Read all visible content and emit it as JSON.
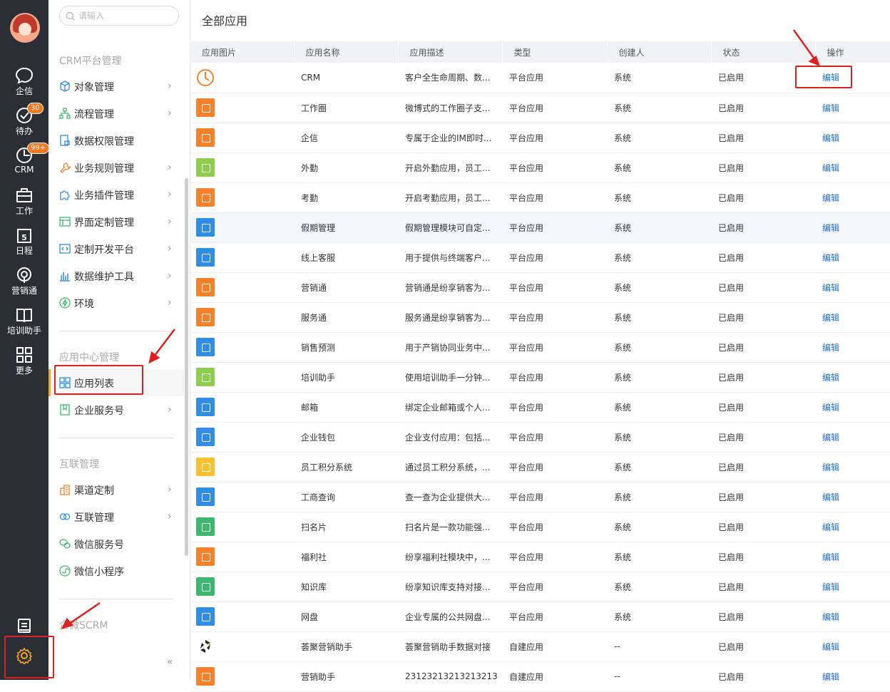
{
  "rail": {
    "items": [
      {
        "label": "企信",
        "icon": "chat-bubble-icon"
      },
      {
        "label": "待办",
        "icon": "check-circle-icon",
        "badge": "30"
      },
      {
        "label": "CRM",
        "icon": "pie-clock-icon",
        "badge": "99+"
      },
      {
        "label": "工作",
        "icon": "briefcase-icon"
      },
      {
        "label": "日程",
        "icon": "calendar-icon"
      },
      {
        "label": "营销通",
        "icon": "broadcast-icon"
      },
      {
        "label": "培训助手",
        "icon": "book-icon"
      },
      {
        "label": "更多",
        "icon": "grid-icon"
      }
    ]
  },
  "menu": {
    "search_placeholder": "请输入",
    "sections": [
      {
        "title": "CRM平台管理",
        "items": [
          {
            "label": "对象管理",
            "icon": "cube-icon",
            "chevron": true
          },
          {
            "label": "流程管理",
            "icon": "flow-icon",
            "chevron": true
          },
          {
            "label": "数据权限管理",
            "icon": "lock-doc-icon",
            "chevron": false
          },
          {
            "label": "业务规则管理",
            "icon": "wrench-icon",
            "chevron": true
          },
          {
            "label": "业务插件管理",
            "icon": "puzzle-icon",
            "chevron": true
          },
          {
            "label": "界面定制管理",
            "icon": "layout-icon",
            "chevron": true
          },
          {
            "label": "定制开发平台",
            "icon": "code-icon",
            "chevron": true
          },
          {
            "label": "数据维护工具",
            "icon": "bar-chart-icon",
            "chevron": true
          },
          {
            "label": "环境",
            "icon": "lightning-icon",
            "chevron": true
          }
        ]
      },
      {
        "title": "应用中心管理",
        "items": [
          {
            "label": "应用列表",
            "icon": "app-grid-icon",
            "chevron": false,
            "active": true
          },
          {
            "label": "企业服务号",
            "icon": "bookmark-icon",
            "chevron": true
          }
        ]
      },
      {
        "title": "互联管理",
        "items": [
          {
            "label": "渠道定制",
            "icon": "building-icon",
            "chevron": true
          },
          {
            "label": "互联管理",
            "icon": "link-rings-icon",
            "chevron": true
          },
          {
            "label": "微信服务号",
            "icon": "wechat-icon",
            "chevron": false
          },
          {
            "label": "微信小程序",
            "icon": "miniprogram-icon",
            "chevron": false
          }
        ]
      },
      {
        "title": "企微SCRM",
        "items": []
      }
    ],
    "collapse_glyph": "«"
  },
  "main": {
    "title": "全部应用",
    "columns": [
      "应用图片",
      "应用名称",
      "应用描述",
      "类型",
      "创建人",
      "状态",
      "操作"
    ],
    "rows": [
      {
        "icon_color": "#f5822a",
        "icon": "crm-clock-icon",
        "name": "CRM",
        "desc": "客户全生命周期、数...",
        "type": "平台应用",
        "creator": "系统",
        "status": "已启用",
        "action": "编辑"
      },
      {
        "icon_color": "#f5822a",
        "icon": "home-icon",
        "name": "工作圈",
        "desc": "微博式的工作圈子支...",
        "type": "平台应用",
        "creator": "系统",
        "status": "已启用",
        "action": "编辑"
      },
      {
        "icon_color": "#f5822a",
        "icon": "chat-icon",
        "name": "企信",
        "desc": "专属于企业的IM即时...",
        "type": "平台应用",
        "creator": "系统",
        "status": "已启用",
        "action": "编辑"
      },
      {
        "icon_color": "#8fcd4f",
        "icon": "location-icon",
        "name": "外勤",
        "desc": "开启外勤应用，员工...",
        "type": "平台应用",
        "creator": "系统",
        "status": "已启用",
        "action": "编辑"
      },
      {
        "icon_color": "#f5822a",
        "icon": "location-icon",
        "name": "考勤",
        "desc": "开启考勤应用，员工...",
        "type": "平台应用",
        "creator": "系统",
        "status": "已启用",
        "action": "编辑"
      },
      {
        "icon_color": "#2f8de4",
        "icon": "calendar-check-icon",
        "name": "假期管理",
        "desc": "假期管理模块可自定...",
        "type": "平台应用",
        "creator": "系统",
        "status": "已启用",
        "action": "编辑"
      },
      {
        "icon_color": "#2f8de4",
        "icon": "headset-icon",
        "name": "线上客服",
        "desc": "用于提供与终端客户...",
        "type": "平台应用",
        "creator": "系统",
        "status": "已启用",
        "action": "编辑"
      },
      {
        "icon_color": "#f5822a",
        "icon": "broadcast-icon",
        "name": "营销通",
        "desc": "营销通是纷享销客为...",
        "type": "平台应用",
        "creator": "系统",
        "status": "已启用",
        "action": "编辑"
      },
      {
        "icon_color": "#f5822a",
        "icon": "service-icon",
        "name": "服务通",
        "desc": "服务通是纷享销客为...",
        "type": "平台应用",
        "creator": "系统",
        "status": "已启用",
        "action": "编辑"
      },
      {
        "icon_color": "#2f8de4",
        "icon": "forecast-icon",
        "name": "销售预测",
        "desc": "用于产销协同业务中...",
        "type": "平台应用",
        "creator": "系统",
        "status": "已启用",
        "action": "编辑"
      },
      {
        "icon_color": "#8fcd4f",
        "icon": "book-icon",
        "name": "培训助手",
        "desc": "使用培训助手一分钟...",
        "type": "平台应用",
        "creator": "系统",
        "status": "已启用",
        "action": "编辑"
      },
      {
        "icon_color": "#2f8de4",
        "icon": "mail-icon",
        "name": "邮箱",
        "desc": "绑定企业邮箱或个人...",
        "type": "平台应用",
        "creator": "系统",
        "status": "已启用",
        "action": "编辑"
      },
      {
        "icon_color": "#2f8de4",
        "icon": "wallet-icon",
        "name": "企业钱包",
        "desc": "企业支付应用：包括...",
        "type": "平台应用",
        "creator": "系统",
        "status": "已启用",
        "action": "编辑"
      },
      {
        "icon_color": "#fbc02d",
        "icon": "points-icon",
        "name": "员工积分系统",
        "desc": "通过员工积分系统，...",
        "type": "平台应用",
        "creator": "系统",
        "status": "已启用",
        "action": "编辑"
      },
      {
        "icon_color": "#2f8de4",
        "icon": "business-query-icon",
        "name": "工商查询",
        "desc": "查一查为企业提供大...",
        "type": "平台应用",
        "creator": "系统",
        "status": "已启用",
        "action": "编辑"
      },
      {
        "icon_color": "#3fb86f",
        "icon": "scan-card-icon",
        "name": "扫名片",
        "desc": "扫名片是一款功能强...",
        "type": "平台应用",
        "creator": "系统",
        "status": "已启用",
        "action": "编辑"
      },
      {
        "icon_color": "#f5822a",
        "icon": "gift-icon",
        "name": "福利社",
        "desc": "纷享福利社模块中，...",
        "type": "平台应用",
        "creator": "系统",
        "status": "已启用",
        "action": "编辑"
      },
      {
        "icon_color": "#3fb86f",
        "icon": "knowledge-icon",
        "name": "知识库",
        "desc": "纷享知识库支持对接...",
        "type": "平台应用",
        "creator": "系统",
        "status": "已启用",
        "action": "编辑"
      },
      {
        "icon_color": "#2f8de4",
        "icon": "disk-icon",
        "name": "网盘",
        "desc": "企业专属的公共网盘...",
        "type": "平台应用",
        "creator": "系统",
        "status": "已启用",
        "action": "编辑"
      },
      {
        "icon_color": "#222222",
        "icon": "huiju-logo-icon",
        "name": "荟聚营销助手",
        "desc": "荟聚营销助手数据对接",
        "type": "自建应用",
        "creator": "--",
        "status": "已启用",
        "action": "编辑"
      },
      {
        "icon_color": "#f5822a",
        "icon": "marketing-icon",
        "name": "营销助手",
        "desc": "23123213213213213",
        "type": "自建应用",
        "creator": "--",
        "status": "已启用",
        "action": "编辑"
      }
    ]
  },
  "colors": {
    "accent": "#f5a623",
    "link": "#1e6fd9",
    "annotation": "#e02020",
    "rail_bg": "#2c2e35"
  }
}
